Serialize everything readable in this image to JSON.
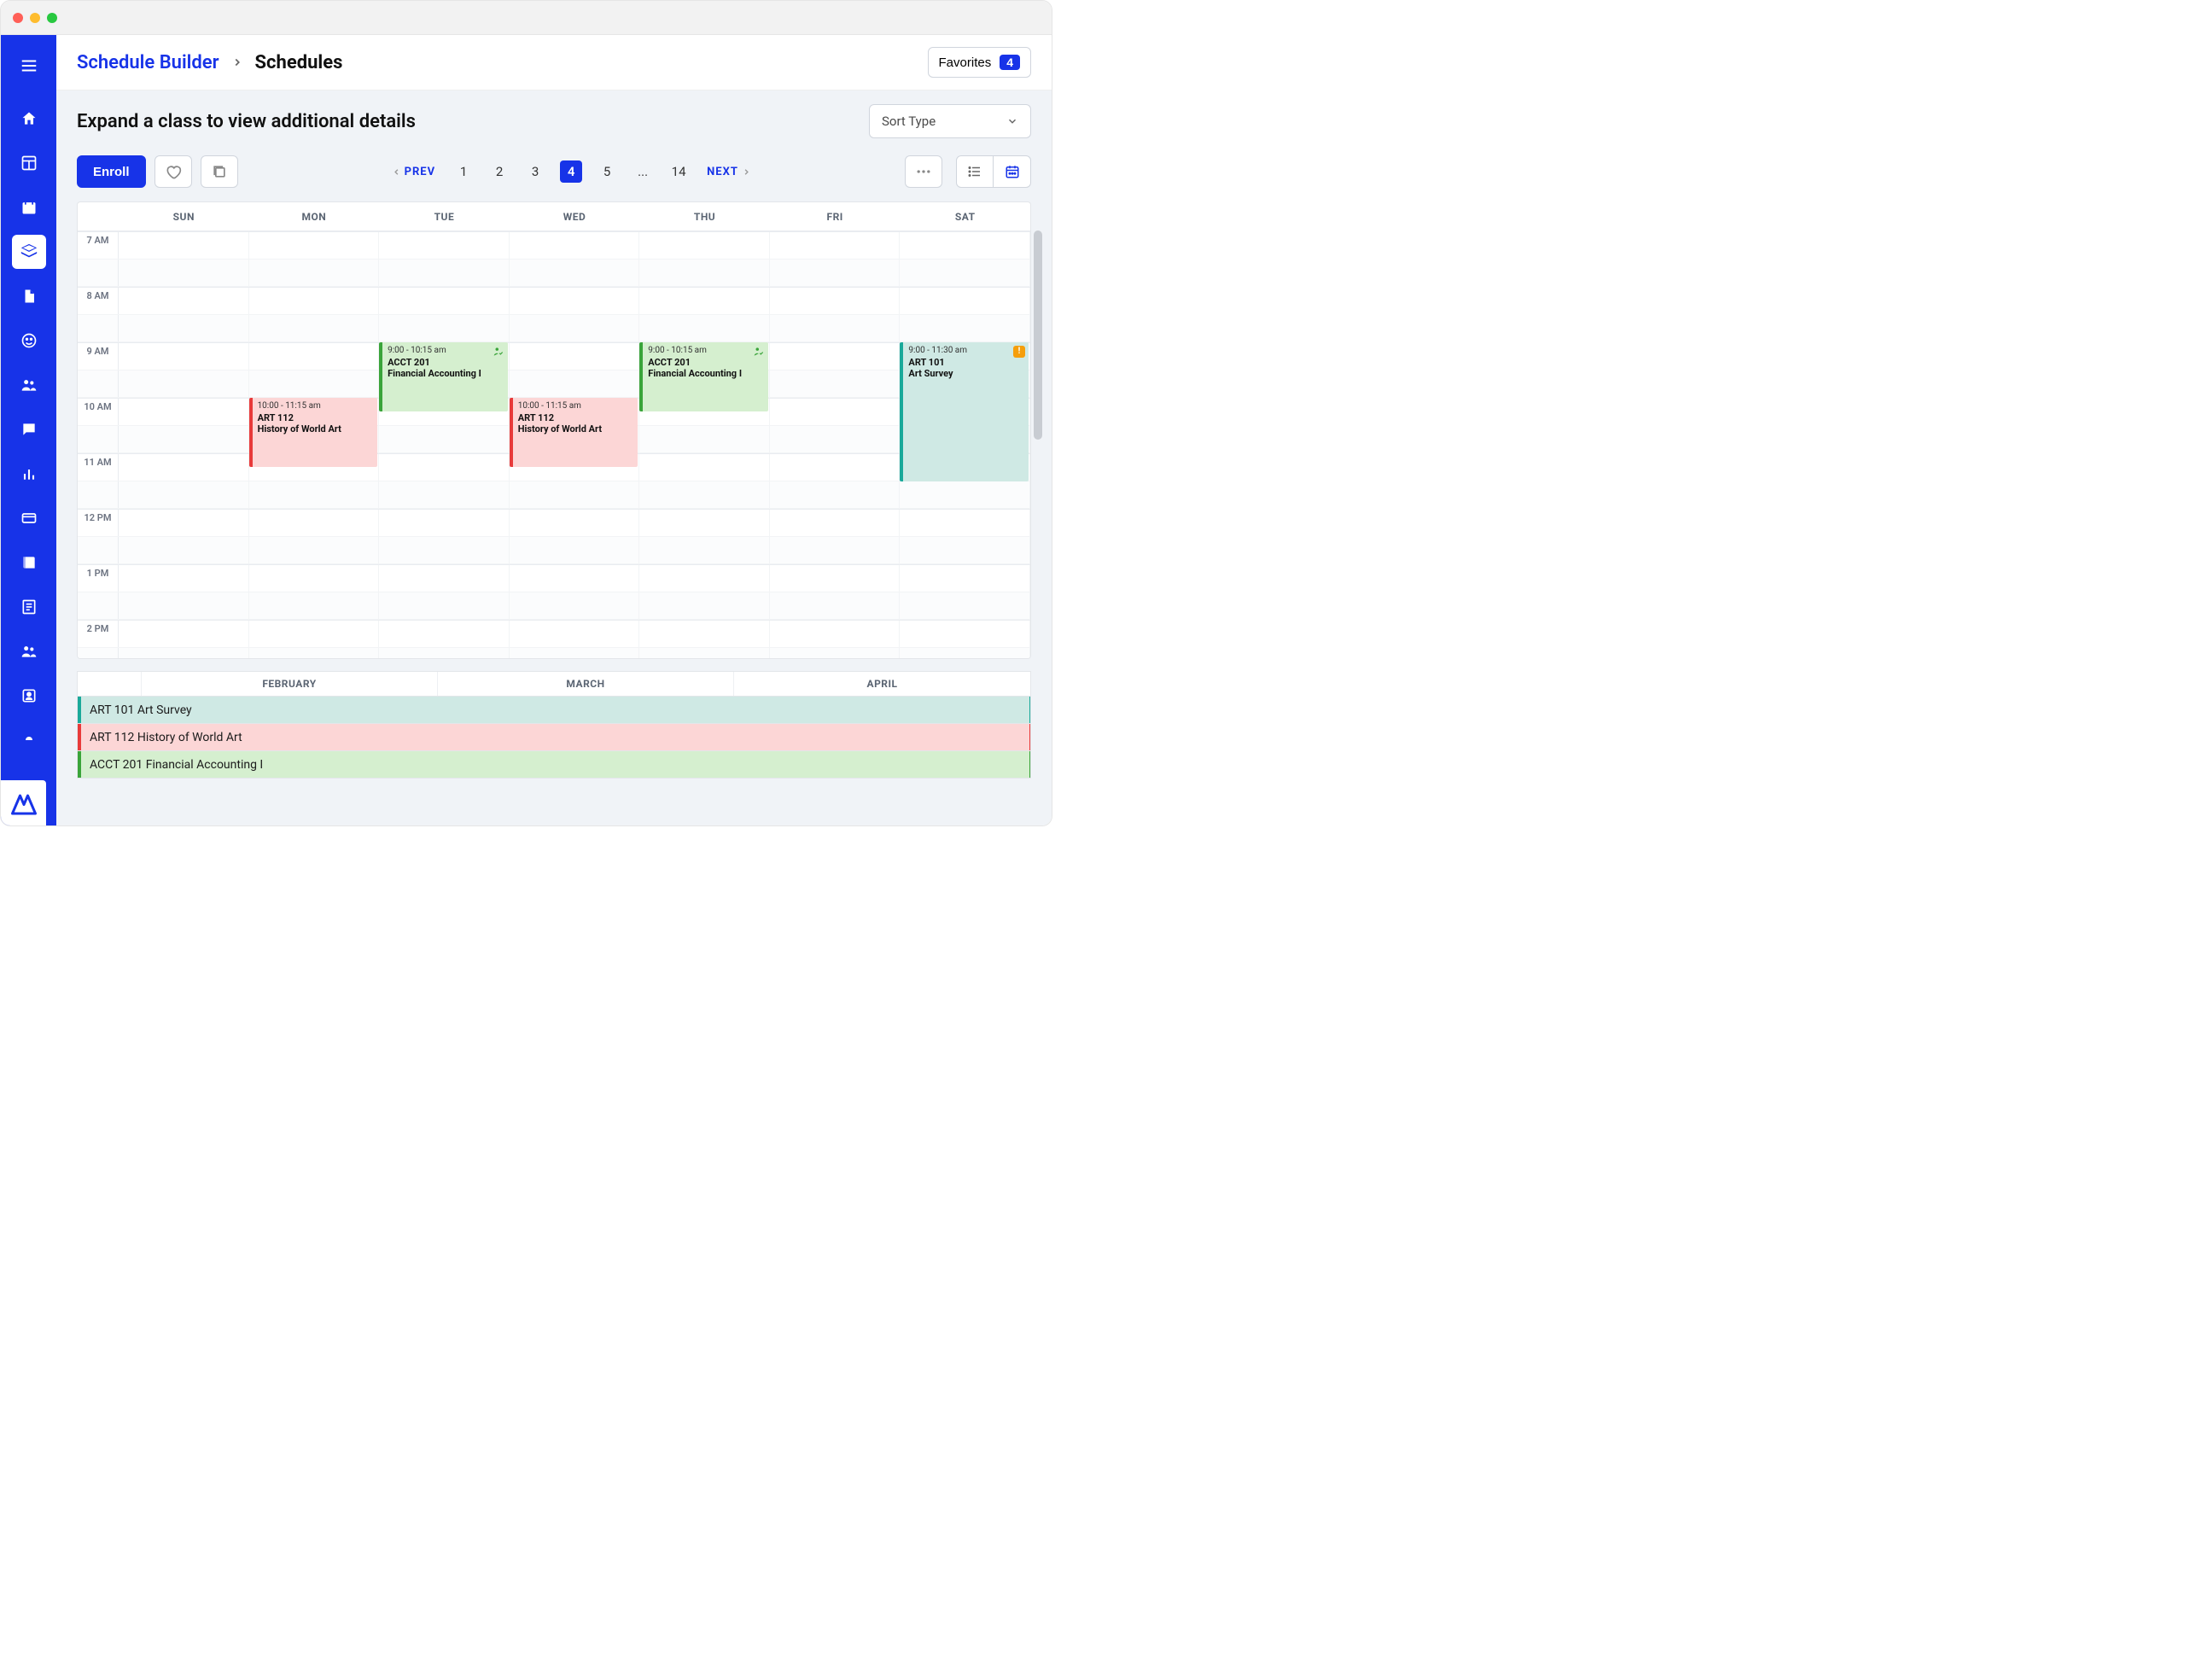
{
  "breadcrumb": {
    "parent": "Schedule Builder",
    "current": "Schedules"
  },
  "favorites": {
    "label": "Favorites",
    "count": "4"
  },
  "subhead": {
    "title": "Expand a class to view additional details"
  },
  "sort": {
    "label": "Sort Type"
  },
  "toolbar": {
    "enroll": "Enroll"
  },
  "pager": {
    "prev": "PREV",
    "next": "NEXT",
    "pages": [
      "1",
      "2",
      "3",
      "4",
      "5",
      "...",
      "14"
    ],
    "active": "4"
  },
  "days": [
    "SUN",
    "MON",
    "TUE",
    "WED",
    "THU",
    "FRI",
    "SAT"
  ],
  "hours": [
    "7 AM",
    "8 AM",
    "9 AM",
    "10 AM",
    "11 AM",
    "12 PM",
    "1 PM",
    "2 PM"
  ],
  "events": [
    {
      "day": 2,
      "start": 9.0,
      "end": 10.25,
      "time": "9:00 - 10:15 am",
      "code": "ACCT 201",
      "name": "Financial Accounting I",
      "color": "green",
      "check": true
    },
    {
      "day": 4,
      "start": 9.0,
      "end": 10.25,
      "time": "9:00 - 10:15 am",
      "code": "ACCT 201",
      "name": "Financial Accounting I",
      "color": "green",
      "check": true
    },
    {
      "day": 1,
      "start": 10.0,
      "end": 11.25,
      "time": "10:00 - 11:15 am",
      "code": "ART 112",
      "name": "History of World Art",
      "color": "red"
    },
    {
      "day": 3,
      "start": 10.0,
      "end": 11.25,
      "time": "10:00 - 11:15 am",
      "code": "ART 112",
      "name": "History of World Art",
      "color": "red"
    },
    {
      "day": 6,
      "start": 9.0,
      "end": 11.5,
      "time": "9:00 - 11:30 am",
      "code": "ART 101",
      "name": "Art Survey",
      "color": "teal",
      "warn": true
    }
  ],
  "term_months": [
    "FEBRUARY",
    "MARCH",
    "APRIL"
  ],
  "term_rows": [
    {
      "label": "ART 101 Art Survey",
      "color": "teal"
    },
    {
      "label": "ART 112 History of World Art",
      "color": "red"
    },
    {
      "label": "ACCT 201 Financial Accounting I",
      "color": "green"
    }
  ]
}
